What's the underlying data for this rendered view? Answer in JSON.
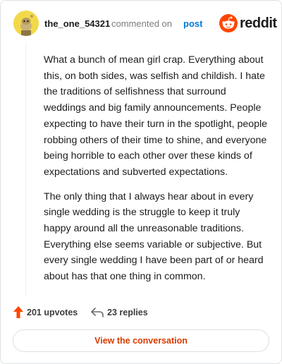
{
  "comment": {
    "username": "the_one_54321",
    "action_text": "commented on",
    "post_link": "post",
    "paragraphs": [
      "What a bunch of mean girl crap. Everything about this, on both sides, was selfish and childish. I hate the traditions of selfishness that surround weddings and big family announcements. People expecting to have their turn in the spotlight, people robbing others of their time to shine, and everyone being horrible to each other over these kinds of expectations and subverted expectations.",
      "The only thing that I always hear about in every single wedding is the struggle to keep it truly happy around all the unreasonable traditions. Everything else seems variable or subjective. But every single wedding I have been part of or heard about has that one thing in common."
    ]
  },
  "brand": {
    "name": "reddit",
    "accent": "#ff4500"
  },
  "actions": {
    "upvotes": "201 upvotes",
    "replies": "23 replies",
    "view_button": "View the conversation"
  },
  "icons": {
    "avatar": "snoo-avatar-icon",
    "upvote": "upvote-arrow-icon",
    "reply": "reply-arrow-icon",
    "logo": "reddit-alien-icon"
  }
}
